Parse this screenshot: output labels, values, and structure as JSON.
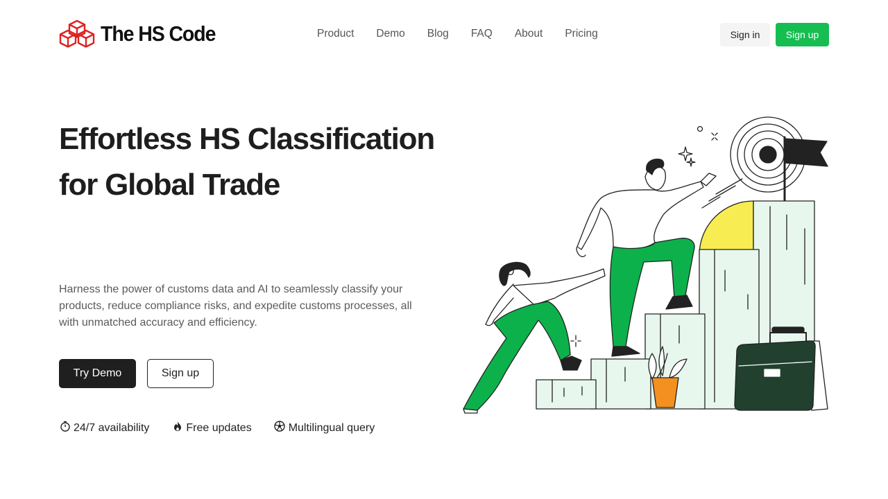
{
  "brand": {
    "name": "The HS Code",
    "logo_color": "#e02020"
  },
  "nav": {
    "items": [
      {
        "label": "Product"
      },
      {
        "label": "Demo"
      },
      {
        "label": "Blog"
      },
      {
        "label": "FAQ"
      },
      {
        "label": "About"
      },
      {
        "label": "Pricing"
      }
    ]
  },
  "auth": {
    "sign_in_label": "Sign in",
    "sign_up_label": "Sign up"
  },
  "hero": {
    "title": "Effortless HS Classification for Global Trade",
    "description": "Harness the power of customs data and AI to seamlessly classify your products, reduce compliance risks, and expedite customs processes, all with unmatched accuracy and efficiency.",
    "primary_cta": "Try Demo",
    "secondary_cta": "Sign up"
  },
  "features": [
    {
      "icon": "stopwatch-icon",
      "label": "24/7 availability"
    },
    {
      "icon": "flame-icon",
      "label": "Free updates"
    },
    {
      "icon": "globe-icon",
      "label": "Multilingual query"
    }
  ],
  "colors": {
    "accent_green": "#16bd50",
    "dark": "#1f1f1f",
    "illustration_green": "#0db14b",
    "illustration_mint": "#e8f7ee",
    "illustration_yellow": "#f7ec52",
    "pot_orange": "#f39020",
    "briefcase_dark": "#21412e"
  }
}
